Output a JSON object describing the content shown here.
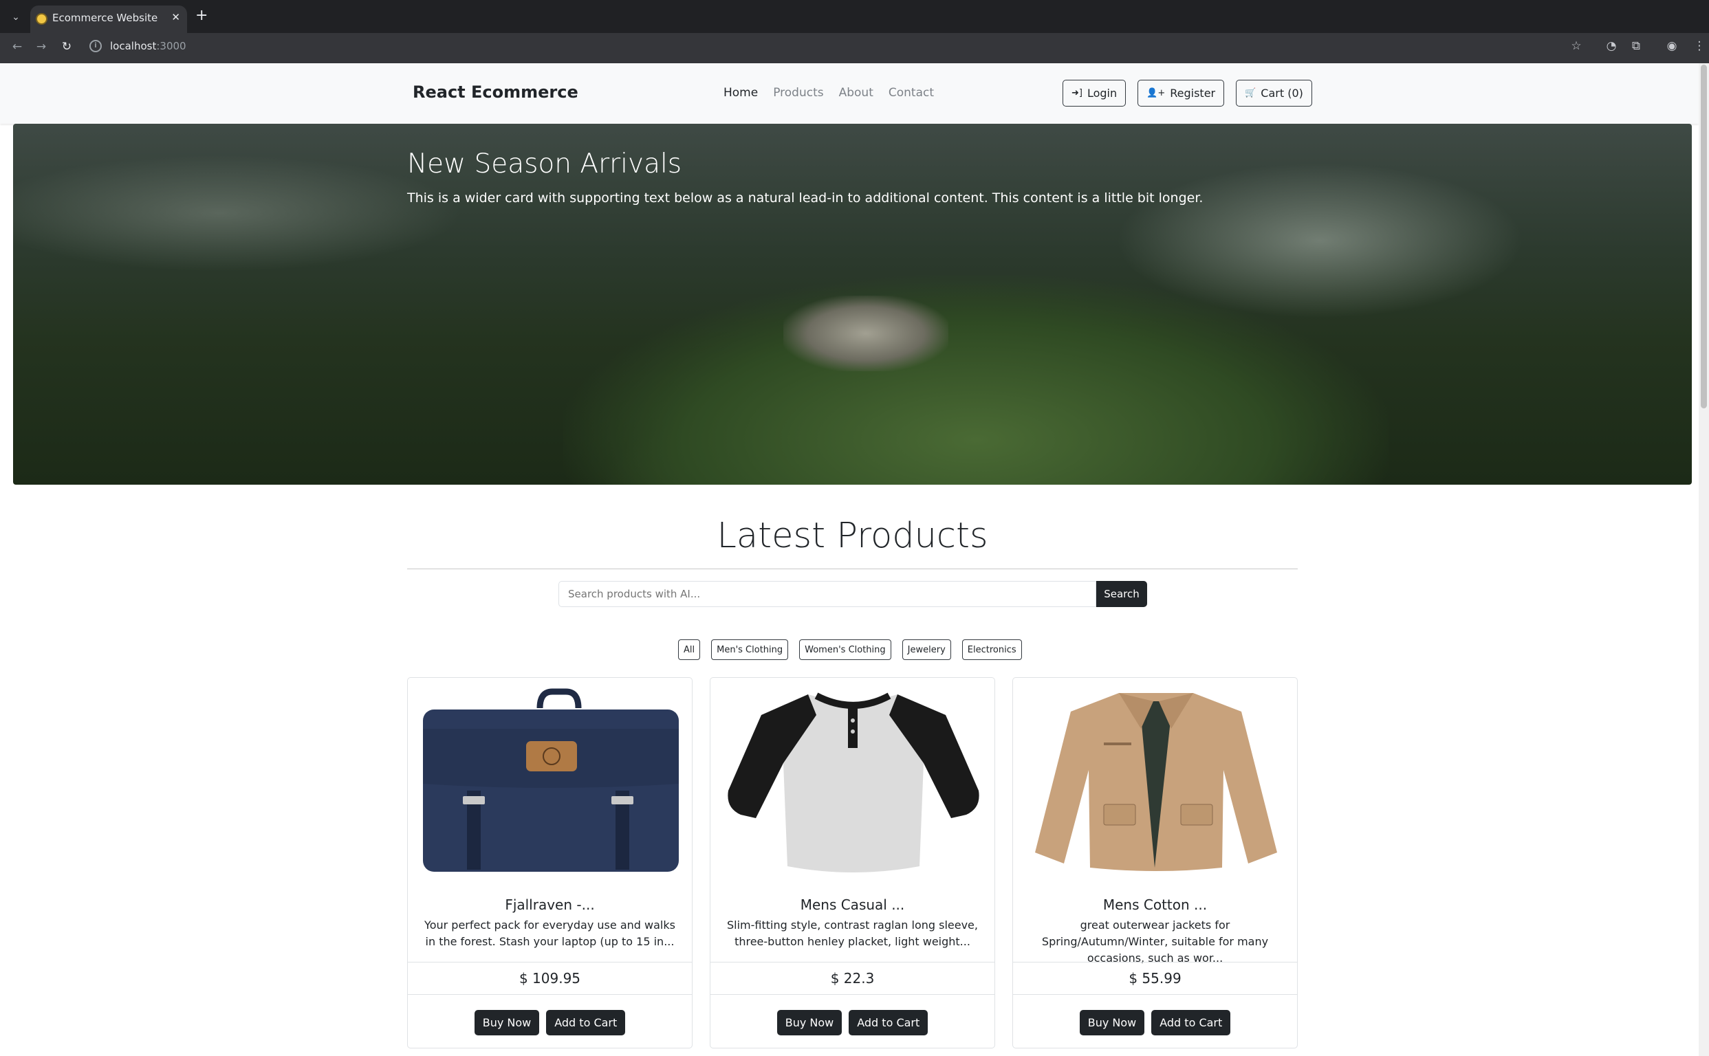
{
  "browser": {
    "tab_title": "Ecommerce Website",
    "address_host": "localhost",
    "address_port": ":3000"
  },
  "navbar": {
    "brand": "React Ecommerce",
    "links": [
      "Home",
      "Products",
      "About",
      "Contact"
    ],
    "active_link": "Home",
    "login_label": "Login",
    "register_label": "Register",
    "cart_label": "Cart (0)"
  },
  "hero": {
    "title": "New Season Arrivals",
    "text": "This is a wider card with supporting text below as a natural lead-in to additional content. This content is a little bit longer."
  },
  "products_section": {
    "title": "Latest Products",
    "search_placeholder": "Search products with AI...",
    "search_button": "Search",
    "filters": [
      "All",
      "Men's Clothing",
      "Women's Clothing",
      "Jewelery",
      "Electronics"
    ]
  },
  "products": [
    {
      "title": "Fjallraven -...",
      "description": "Your perfect pack for everyday use and walks in the forest. Stash your laptop (up to 15 in...",
      "price": "$ 109.95",
      "image": "backpack-image",
      "buy_label": "Buy Now",
      "cart_label": "Add to Cart"
    },
    {
      "title": "Mens Casual ...",
      "description": "Slim-fitting style, contrast raglan long sleeve, three-button henley placket, light weight...",
      "price": "$ 22.3",
      "image": "raglan-shirt-image",
      "buy_label": "Buy Now",
      "cart_label": "Add to Cart"
    },
    {
      "title": "Mens Cotton ...",
      "description": "great outerwear jackets for Spring/Autumn/Winter, suitable for many occasions, such as wor...",
      "price": "$ 55.99",
      "image": "jacket-image",
      "buy_label": "Buy Now",
      "cart_label": "Add to Cart"
    }
  ],
  "colors": {
    "dark": "#212529",
    "navbar_bg": "#f8f9fa",
    "chrome_bg": "#202124"
  }
}
